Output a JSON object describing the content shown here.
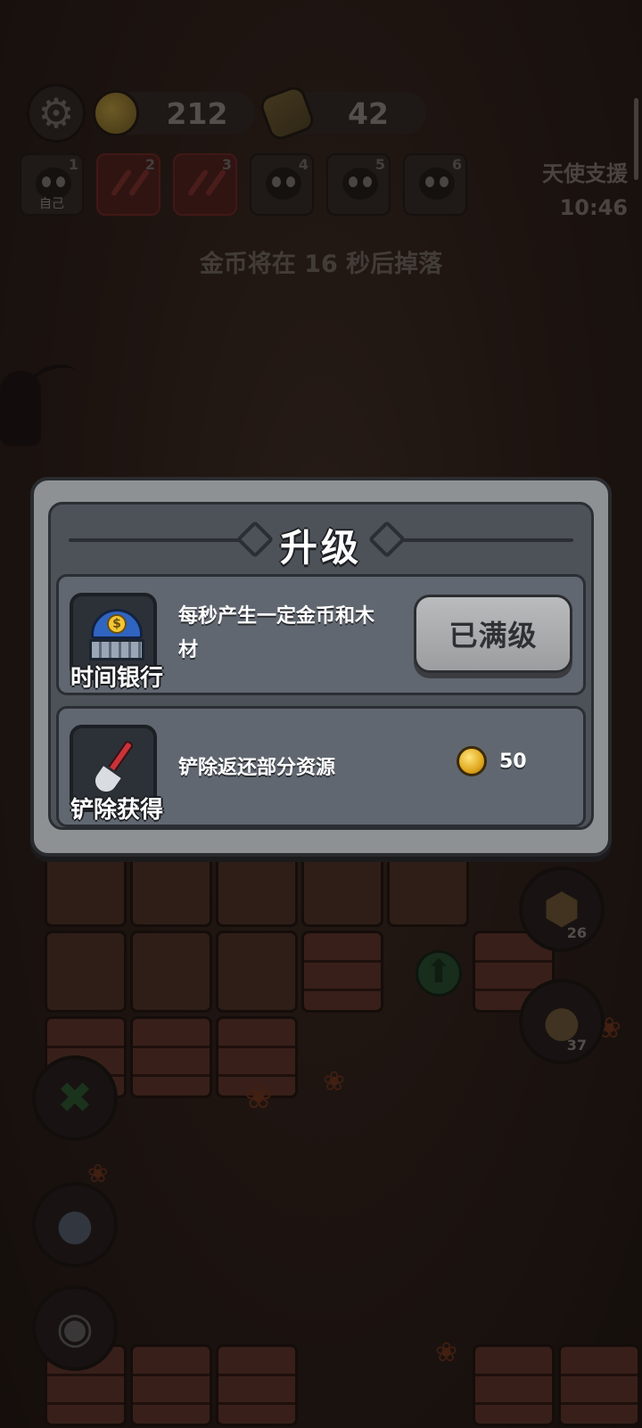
{
  "hud": {
    "settings_icon": "gear-icon",
    "coins": "212",
    "wood": "42",
    "players": [
      {
        "number": "1",
        "label": "自己",
        "state": "normal"
      },
      {
        "number": "2",
        "label": "",
        "state": "red"
      },
      {
        "number": "3",
        "label": "",
        "state": "red"
      },
      {
        "number": "4",
        "label": "",
        "state": "normal"
      },
      {
        "number": "5",
        "label": "",
        "state": "normal"
      },
      {
        "number": "6",
        "label": "",
        "state": "normal"
      }
    ],
    "angel_support": "天使支援",
    "timer": "10:46",
    "notice": "金币将在 16 秒后掉落"
  },
  "side_buttons": {
    "shield_count": "26",
    "poop_count": "37"
  },
  "dialog": {
    "title": "升级",
    "items": [
      {
        "name": "时间银行",
        "description": "每秒产生一定金币和木材",
        "button": "已满级",
        "icon": "bank-icon"
      },
      {
        "name": "铲除获得",
        "description": "铲除返还部分资源",
        "cost": "50",
        "icon": "shovel-icon"
      }
    ]
  },
  "colors": {
    "dialog_frame": "#8e9194",
    "dialog_panel": "#4d5259",
    "card": "#616770",
    "max_button": "#b0b2b4",
    "coin": "#e0a81f"
  }
}
